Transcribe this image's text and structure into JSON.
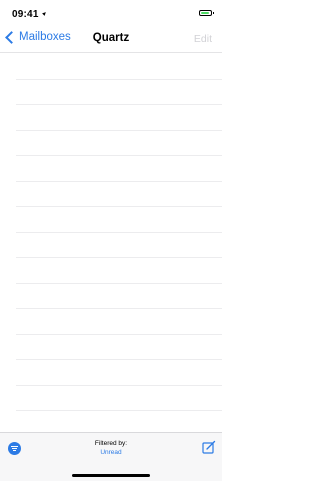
{
  "status_bar": {
    "time": "09:41",
    "location_icon": "location-arrow-icon",
    "battery_icon": "battery-icon",
    "battery_level": 0.9,
    "battery_color": "#4cd964"
  },
  "nav": {
    "back_label": "Mailboxes",
    "back_icon": "chevron-left-icon",
    "title": "Quartz",
    "edit_label": "Edit"
  },
  "message_list": {
    "empty_rows": 15
  },
  "toolbar": {
    "filter_icon": "filter-icon",
    "filtered_by_label": "Filtered by:",
    "filter_value": "Unread",
    "compose_icon": "compose-icon"
  },
  "colors": {
    "accent": "#2c7be5",
    "disabled": "#d2d2d6",
    "separator": "#ececee",
    "toolbar_bg": "#f7f7f8"
  }
}
